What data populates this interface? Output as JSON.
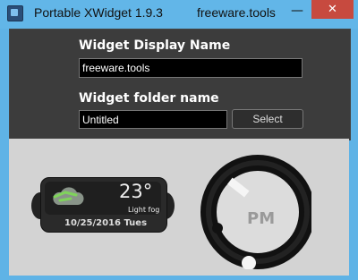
{
  "window": {
    "title": "Portable XWidget 1.9.3",
    "title_extra": "freeware.tools",
    "minimize_symbol": "—",
    "close_symbol": "✕",
    "accent_color": "#5fb3e6",
    "close_color": "#c74a3f"
  },
  "form": {
    "display_name_label": "Widget Display Name",
    "display_name_value": "freeware.tools",
    "folder_label": "Widget folder name",
    "folder_value": "Untitled",
    "select_label": "Select"
  },
  "widgets": {
    "weather": {
      "temperature": "23°",
      "condition": "Light fog",
      "date": "10/25/2016 Tues",
      "icon": "cloud-icon"
    },
    "clock": {
      "period": "PM"
    }
  }
}
